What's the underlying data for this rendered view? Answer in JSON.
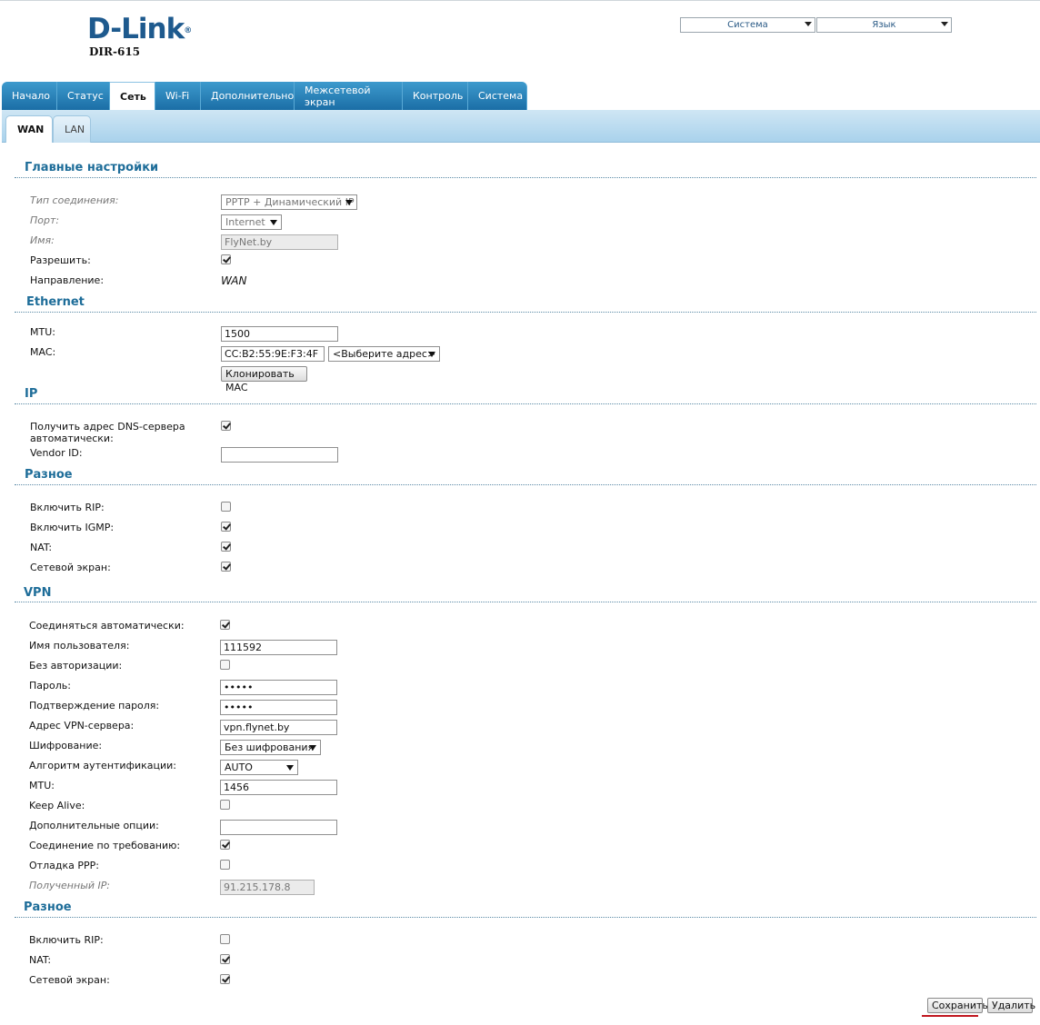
{
  "header": {
    "brand": "D-Link",
    "model": "DIR-615",
    "system_select": "Система",
    "language_select": "Язык"
  },
  "nav": {
    "tabs": [
      "Начало",
      "Статус",
      "Сеть",
      "Wi-Fi",
      "Дополнительно",
      "Межсетевой экран",
      "Контроль",
      "Система"
    ],
    "active": "Сеть"
  },
  "subtabs": {
    "wan": "WAN",
    "lan": "LAN",
    "active": "WAN"
  },
  "main": {
    "title": "Главные настройки",
    "connection_type_label": "Тип соединения:",
    "connection_type_value": "PPTP + Динамический IP",
    "port_label": "Порт:",
    "port_value": "Internet",
    "name_label": "Имя:",
    "name_value": "FlyNet.by",
    "enable_label": "Разрешить:",
    "enable_checked": true,
    "direction_label": "Направление:",
    "direction_value": "WAN"
  },
  "ethernet": {
    "title": "Ethernet",
    "mtu_label": "MTU:",
    "mtu_value": "1500",
    "mac_label": "MAC:",
    "mac_value": "CC:B2:55:9E:F3:4F",
    "mac_select": "<Выберите адрес>",
    "clone_button": "Клонировать MAC"
  },
  "ip": {
    "title": "IP",
    "dns_auto_label": "Получить адрес DNS-сервера автоматически:",
    "dns_auto_checked": true,
    "vendor_label": "Vendor ID:",
    "vendor_value": ""
  },
  "misc1": {
    "title": "Разное",
    "rip_label": "Включить RIP:",
    "rip_checked": false,
    "igmp_label": "Включить IGMP:",
    "igmp_checked": true,
    "nat_label": "NAT:",
    "nat_checked": true,
    "firewall_label": "Сетевой экран:",
    "firewall_checked": true
  },
  "vpn": {
    "title": "VPN",
    "auto_connect_label": "Соединяться автоматически:",
    "auto_connect_checked": true,
    "username_label": "Имя пользователя:",
    "username_value": "111592",
    "no_auth_label": "Без авторизации:",
    "no_auth_checked": false,
    "password_label": "Пароль:",
    "password_value": "•••••",
    "confirm_label": "Подтверждение пароля:",
    "confirm_value": "•••••",
    "server_label": "Адрес VPN-сервера:",
    "server_value": "vpn.flynet.by",
    "encryption_label": "Шифрование:",
    "encryption_value": "Без шифрования",
    "auth_algo_label": "Алгоритм аутентификации:",
    "auth_algo_value": "AUTO",
    "mtu_label": "MTU:",
    "mtu_value": "1456",
    "keepalive_label": "Keep Alive:",
    "keepalive_checked": false,
    "extra_label": "Дополнительные опции:",
    "extra_value": "",
    "on_demand_label": "Соединение по требованию:",
    "on_demand_checked": true,
    "ppp_debug_label": "Отладка PPP:",
    "ppp_debug_checked": false,
    "received_ip_label": "Полученный IP:",
    "received_ip_value": "91.215.178.8"
  },
  "misc2": {
    "title": "Разное",
    "rip_label": "Включить RIP:",
    "rip_checked": false,
    "nat_label": "NAT:",
    "nat_checked": true,
    "firewall_label": "Сетевой экран:",
    "firewall_checked": true
  },
  "actions": {
    "save": "Сохранить",
    "delete": "Удалить"
  },
  "colors": {
    "accent": "#1e6d99",
    "nav": "#1b6ea6",
    "highlight": "#c0161e"
  }
}
